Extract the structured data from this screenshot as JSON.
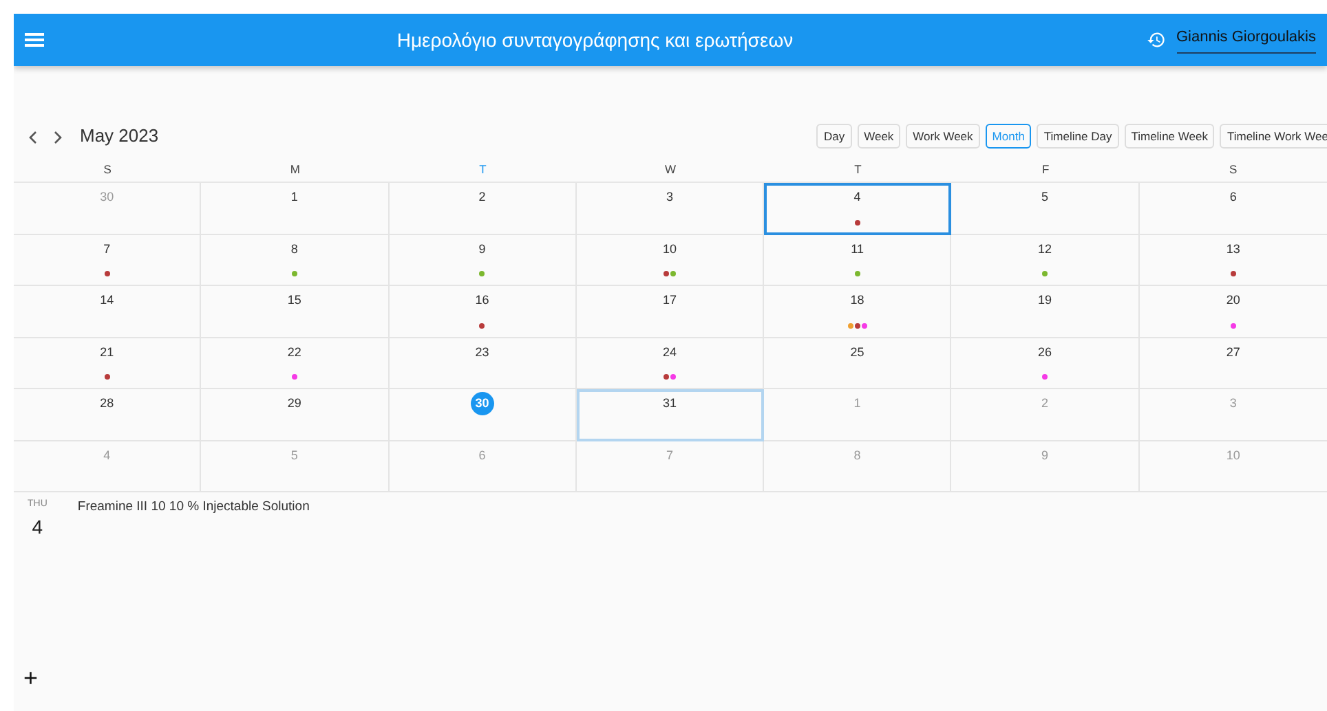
{
  "app_bar": {
    "title": "Ημερολόγιο συνταγογράφησης και ερωτήσεων",
    "user": "Giannis Giorgoulakis"
  },
  "toolbar": {
    "month_label": "May 2023",
    "views": [
      {
        "label": "Day",
        "selected": false
      },
      {
        "label": "Week",
        "selected": false
      },
      {
        "label": "Work Week",
        "selected": false
      },
      {
        "label": "Month",
        "selected": true
      },
      {
        "label": "Timeline Day",
        "selected": false
      },
      {
        "label": "Timeline Week",
        "selected": false
      },
      {
        "label": "Timeline Work Wee",
        "selected": false
      }
    ]
  },
  "weekdays": [
    {
      "label": "S",
      "today": false
    },
    {
      "label": "M",
      "today": false
    },
    {
      "label": "T",
      "today": true
    },
    {
      "label": "W",
      "today": false
    },
    {
      "label": "T",
      "today": false
    },
    {
      "label": "F",
      "today": false
    },
    {
      "label": "S",
      "today": false
    }
  ],
  "weeks": [
    [
      {
        "day": "30",
        "other_month": true
      },
      {
        "day": "1"
      },
      {
        "day": "2"
      },
      {
        "day": "3"
      },
      {
        "day": "4",
        "selected": true,
        "events": [
          {
            "color": "#b83b3b"
          }
        ]
      },
      {
        "day": "5"
      },
      {
        "day": "6"
      }
    ],
    [
      {
        "day": "7",
        "events": [
          {
            "color": "#b83b3b"
          }
        ]
      },
      {
        "day": "8",
        "events": [
          {
            "color": "#7cb82f"
          }
        ]
      },
      {
        "day": "9",
        "events": [
          {
            "color": "#7cb82f"
          }
        ]
      },
      {
        "day": "10",
        "events": [
          {
            "color": "#b83b3b"
          },
          {
            "color": "#7cb82f"
          }
        ]
      },
      {
        "day": "11",
        "events": [
          {
            "color": "#7cb82f"
          }
        ]
      },
      {
        "day": "12",
        "events": [
          {
            "color": "#7cb82f"
          }
        ]
      },
      {
        "day": "13",
        "events": [
          {
            "color": "#b83b3b"
          }
        ]
      }
    ],
    [
      {
        "day": "14"
      },
      {
        "day": "15"
      },
      {
        "day": "16",
        "events": [
          {
            "color": "#b83b3b"
          }
        ]
      },
      {
        "day": "17"
      },
      {
        "day": "18",
        "events": [
          {
            "color": "#f0a030"
          },
          {
            "color": "#b83b3b"
          },
          {
            "color": "#f53ae6"
          }
        ]
      },
      {
        "day": "19"
      },
      {
        "day": "20",
        "events": [
          {
            "color": "#f53ae6"
          }
        ]
      }
    ],
    [
      {
        "day": "21",
        "events": [
          {
            "color": "#b83b3b"
          }
        ]
      },
      {
        "day": "22",
        "events": [
          {
            "color": "#f53ae6"
          }
        ]
      },
      {
        "day": "23"
      },
      {
        "day": "24",
        "events": [
          {
            "color": "#b83b3b"
          },
          {
            "color": "#f53ae6"
          }
        ]
      },
      {
        "day": "25"
      },
      {
        "day": "26",
        "events": [
          {
            "color": "#f53ae6"
          }
        ]
      },
      {
        "day": "27"
      }
    ],
    [
      {
        "day": "28"
      },
      {
        "day": "29"
      },
      {
        "day": "30",
        "today": true
      },
      {
        "day": "31",
        "hovered": true
      },
      {
        "day": "1",
        "other_month": true
      },
      {
        "day": "2",
        "other_month": true
      },
      {
        "day": "3",
        "other_month": true
      }
    ],
    [
      {
        "day": "4",
        "other_month": true
      },
      {
        "day": "5",
        "other_month": true
      },
      {
        "day": "6",
        "other_month": true
      },
      {
        "day": "7",
        "other_month": true
      },
      {
        "day": "8",
        "other_month": true
      },
      {
        "day": "9",
        "other_month": true
      },
      {
        "day": "10",
        "other_month": true
      }
    ]
  ],
  "agenda": {
    "weekday": "THU",
    "day": "4",
    "items": [
      {
        "title": "Freamine III 10 10 % Injectable Solution"
      }
    ]
  },
  "add_button": {
    "label": "+"
  }
}
